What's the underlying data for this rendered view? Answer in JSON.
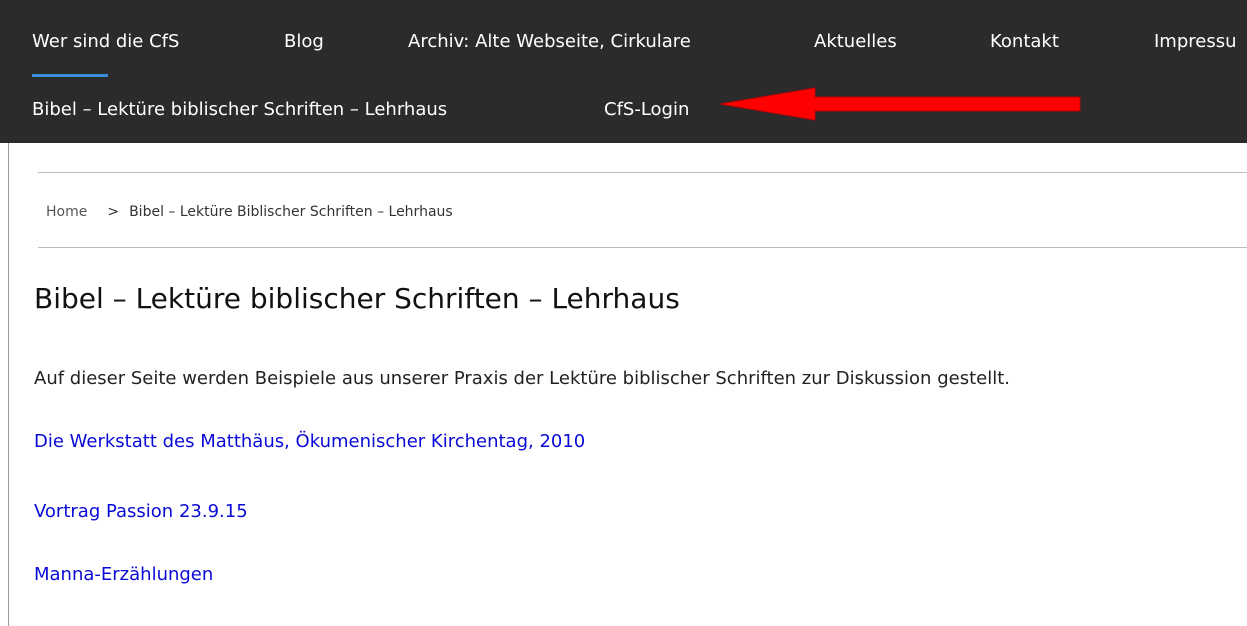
{
  "nav": {
    "row1": [
      "Wer sind die CfS",
      "Blog",
      "Archiv: Alte Webseite, Cirkulare",
      "Aktuelles",
      "Kontakt",
      "Impressu"
    ],
    "row2": [
      "Bibel – Lektüre biblischer Schriften – Lehrhaus",
      "CfS-Login"
    ]
  },
  "breadcrumb": {
    "home": "Home",
    "separator": ">",
    "current": "Bibel – Lektüre Biblischer Schriften – Lehrhaus"
  },
  "page": {
    "title": "Bibel – Lektüre biblischer Schriften – Lehrhaus",
    "intro": "Auf dieser Seite werden Beispiele aus unserer Praxis der Lektüre biblischer Schriften zur Diskussion gestellt.",
    "links": [
      "Die Werkstatt des Matthäus, Ökumenischer Kirchentag, 2010",
      "Vortrag Passion 23.9.15",
      "Manna-Erzählungen"
    ]
  },
  "colors": {
    "nav_background": "#2b2b2b",
    "active_indicator": "#3a8fd9",
    "link": "#0a0ad8",
    "annotation_arrow": "#ff0000"
  },
  "annotation": {
    "icon": "red-arrow-icon"
  }
}
